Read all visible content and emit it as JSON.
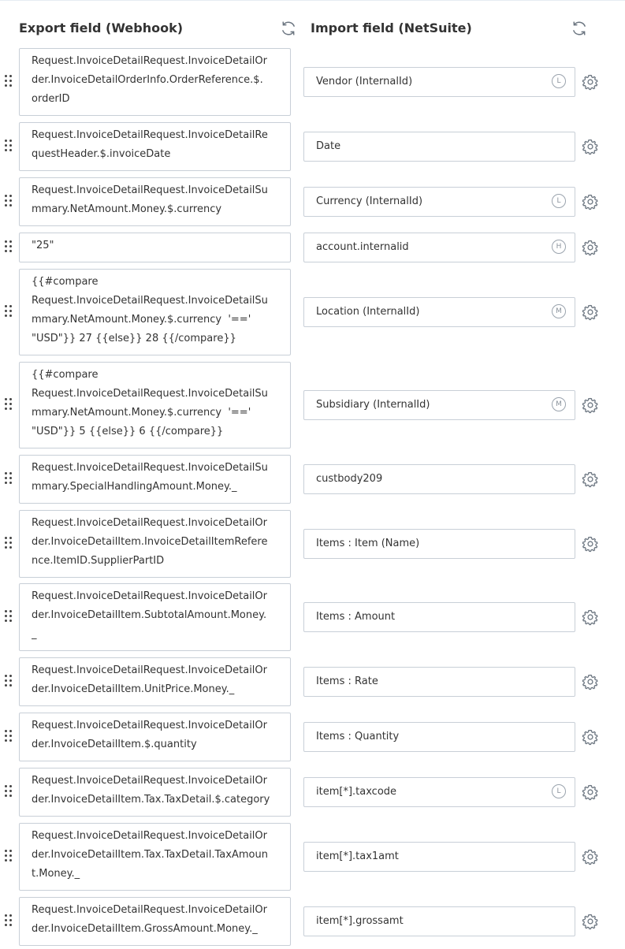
{
  "header": {
    "export_title": "Export field (Webhook)",
    "import_title": "Import field (NetSuite)",
    "export_refresh_icon": "refresh-icon",
    "import_refresh_icon": "refresh-icon"
  },
  "colors": {
    "border": "#c8cfd7",
    "text": "#333333",
    "icon": "#6b7580",
    "badge": "#9aa3ad"
  },
  "rows": [
    {
      "export_lines": [
        "Request.InvoiceDetailRequest.InvoiceDetailOr",
        "der.InvoiceDetailOrderInfo.OrderReference.$.",
        "orderID"
      ],
      "import": "Vendor (InternalId)",
      "badge": "L"
    },
    {
      "export_lines": [
        "Request.InvoiceDetailRequest.InvoiceDetailRe",
        "questHeader.$.invoiceDate"
      ],
      "import": "Date",
      "badge": ""
    },
    {
      "export_lines": [
        "Request.InvoiceDetailRequest.InvoiceDetailSu",
        "mmary.NetAmount.Money.$.currency"
      ],
      "import": "Currency (InternalId)",
      "badge": "L"
    },
    {
      "export_lines": [
        "\"25\""
      ],
      "import": "account.internalid",
      "badge": "H"
    },
    {
      "export_lines": [
        "{{#compare",
        "Request.InvoiceDetailRequest.InvoiceDetailSu",
        "mmary.NetAmount.Money.$.currency  '=='",
        "\"USD\"}} 27 {{else}} 28 {{/compare}}"
      ],
      "import": "Location (InternalId)",
      "badge": "M"
    },
    {
      "export_lines": [
        "{{#compare",
        "Request.InvoiceDetailRequest.InvoiceDetailSu",
        "mmary.NetAmount.Money.$.currency  '=='",
        "\"USD\"}} 5 {{else}} 6 {{/compare}}"
      ],
      "import": "Subsidiary (InternalId)",
      "badge": "M"
    },
    {
      "export_lines": [
        "Request.InvoiceDetailRequest.InvoiceDetailSu",
        "mmary.SpecialHandlingAmount.Money._"
      ],
      "import": "custbody209",
      "badge": ""
    },
    {
      "export_lines": [
        "Request.InvoiceDetailRequest.InvoiceDetailOr",
        "der.InvoiceDetailItem.InvoiceDetailItemRefere",
        "nce.ItemID.SupplierPartID"
      ],
      "import": "Items : Item (Name)",
      "badge": ""
    },
    {
      "export_lines": [
        "Request.InvoiceDetailRequest.InvoiceDetailOr",
        "der.InvoiceDetailItem.SubtotalAmount.Money.",
        "_"
      ],
      "import": "Items : Amount",
      "badge": ""
    },
    {
      "export_lines": [
        "Request.InvoiceDetailRequest.InvoiceDetailOr",
        "der.InvoiceDetailItem.UnitPrice.Money._"
      ],
      "import": "Items : Rate",
      "badge": ""
    },
    {
      "export_lines": [
        "Request.InvoiceDetailRequest.InvoiceDetailOr",
        "der.InvoiceDetailItem.$.quantity"
      ],
      "import": "Items : Quantity",
      "badge": ""
    },
    {
      "export_lines": [
        "Request.InvoiceDetailRequest.InvoiceDetailOr",
        "der.InvoiceDetailItem.Tax.TaxDetail.$.category"
      ],
      "import": "item[*].taxcode",
      "badge": "L"
    },
    {
      "export_lines": [
        "Request.InvoiceDetailRequest.InvoiceDetailOr",
        "der.InvoiceDetailItem.Tax.TaxDetail.TaxAmoun",
        "t.Money._"
      ],
      "import": "item[*].tax1amt",
      "badge": ""
    },
    {
      "export_lines": [
        "Request.InvoiceDetailRequest.InvoiceDetailOr",
        "der.InvoiceDetailItem.GrossAmount.Money._"
      ],
      "import": "item[*].grossamt",
      "badge": ""
    }
  ]
}
